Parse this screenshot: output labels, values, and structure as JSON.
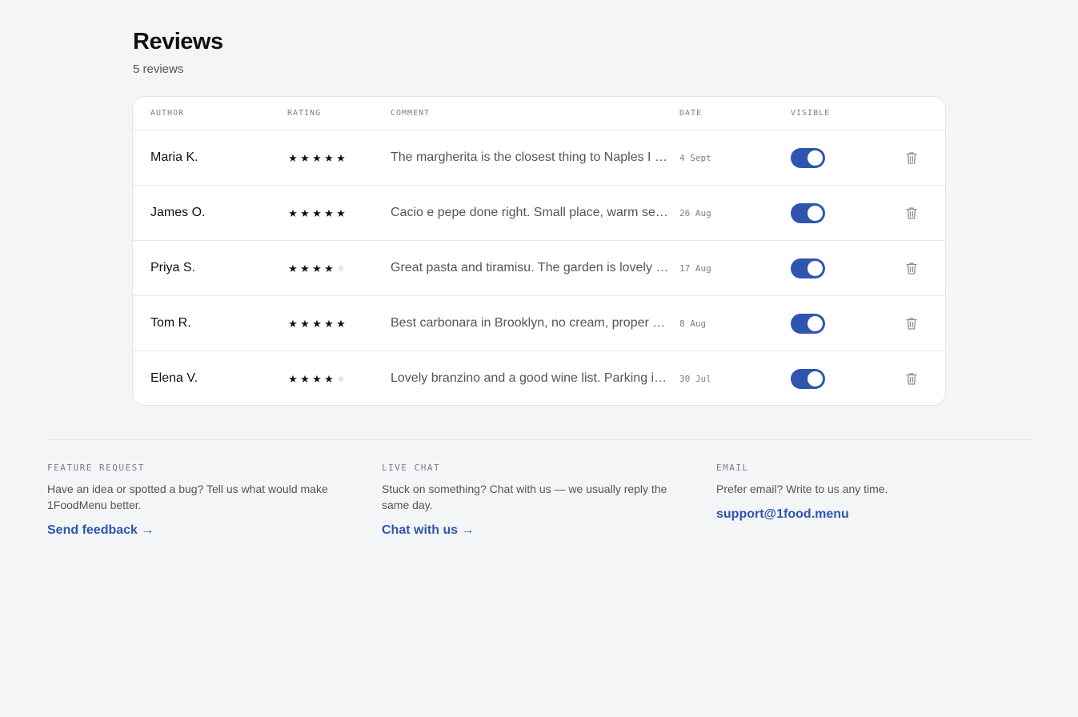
{
  "header": {
    "title": "Reviews",
    "subtitle": "5 reviews"
  },
  "table": {
    "columns": {
      "author": "AUTHOR",
      "rating": "RATING",
      "comment": "COMMENT",
      "date": "DATE",
      "visible": "VISIBLE"
    },
    "rows": [
      {
        "author": "Maria K.",
        "rating": 5,
        "comment": "The margherita is the closest thing to Naples I …",
        "date": "4 Sept",
        "visible": true
      },
      {
        "author": "James O.",
        "rating": 5,
        "comment": "Cacio e pepe done right. Small place, warm ser…",
        "date": "26 Aug",
        "visible": true
      },
      {
        "author": "Priya S.",
        "rating": 4,
        "comment": "Great pasta and tiramisu. The garden is lovely i…",
        "date": "17 Aug",
        "visible": true
      },
      {
        "author": "Tom R.",
        "rating": 5,
        "comment": "Best carbonara in Brooklyn, no cream, proper g…",
        "date": "8 Aug",
        "visible": true
      },
      {
        "author": "Elena V.",
        "rating": 4,
        "comment": "Lovely branzino and a good wine list. Parking is…",
        "date": "30 Jul",
        "visible": true
      }
    ]
  },
  "support": {
    "feature": {
      "label": "FEATURE REQUEST",
      "description": "Have an idea or spotted a bug? Tell us what would make 1FoodMenu better.",
      "link": "Send feedback →"
    },
    "chat": {
      "label": "LIVE CHAT",
      "description": "Stuck on something? Chat with us — we usually reply the same day.",
      "link": "Chat with us →"
    },
    "email": {
      "label": "EMAIL",
      "description": "Prefer email? Write to us any time.",
      "link": "support@1food.menu"
    }
  },
  "colors": {
    "accent": "#2f55b0",
    "background": "#f4f5f7",
    "star_on": "#111111",
    "star_off": "#e2e4e7"
  },
  "icons": {
    "delete": "trash-icon",
    "star": "star-icon"
  }
}
